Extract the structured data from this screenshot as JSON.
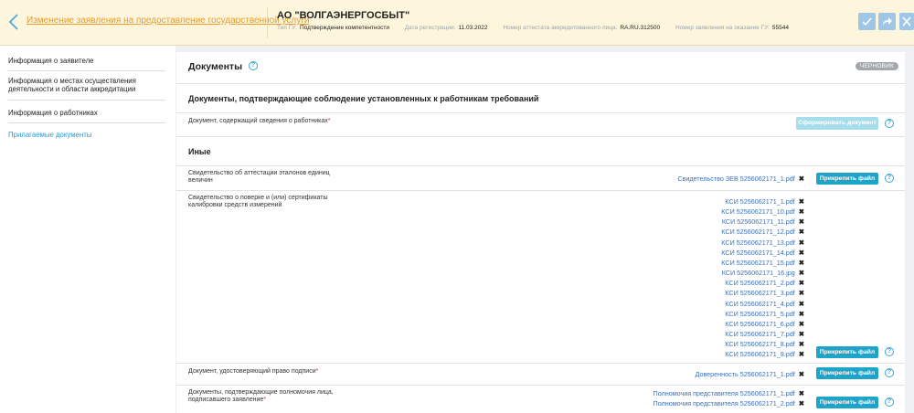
{
  "header": {
    "back_label": "Изменение заявления на предоставление государственной услуги",
    "org_name": "АО \"ВОЛГАЭНЕРГОСБЫТ\"",
    "meta": [
      {
        "label": "Тип ГУ:",
        "value": "Подтверждение компетентности"
      },
      {
        "label": "Дата регистрации:",
        "value": "11.03.2022"
      },
      {
        "label": "Номер аттестата аккредитованного лица:",
        "value": "RA.RU.312500"
      },
      {
        "label": "Номер заявления на оказание ГУ:",
        "value": "55544"
      }
    ],
    "accent_color": "#e79b2e",
    "icons": [
      "chevron-left-icon",
      "check-icon",
      "share-icon",
      "close-icon"
    ]
  },
  "sidebar": {
    "items": [
      {
        "label": "Информация о заявителе"
      },
      {
        "label": "Информация о местах осуществления деятельности и области аккредитации"
      },
      {
        "label": "Информация о работниках"
      },
      {
        "label": "Прилагаемые документы",
        "active": true
      }
    ]
  },
  "main": {
    "title": "Документы",
    "status_badge": "ЧЕРНОВИК",
    "section1_title": "Документы, подтверждающие соблюдение установленных к работникам требований",
    "section1_doc": {
      "label": "Документ, содержащий сведения о работниках",
      "required_mark": "*",
      "button": "Сформировать документ"
    },
    "section2_title": "Иные",
    "attach_button": "Прикрепить файл",
    "docs": [
      {
        "label": "Свидетельство об аттестации эталонов единиц величин",
        "files": [
          "Свидетельство ЗЕВ 5256062171_1.pdf"
        ]
      },
      {
        "label": "Свидетельство о поверке и (или) сертификаты калибровки средств измерений",
        "files": [
          "КСИ 5256062171_1.pdf",
          "КСИ 5256062171_10.pdf",
          "КСИ 5256062171_11.pdf",
          "КСИ 5256062171_12.pdf",
          "КСИ 5256062171_13.pdf",
          "КСИ 5256062171_14.pdf",
          "КСИ 5256062171_15.pdf",
          "КСИ 5256062171_16.jpg",
          "КСИ 5256062171_2.pdf",
          "КСИ 5256062171_3.pdf",
          "КСИ 5256062171_4.pdf",
          "КСИ 5256062171_5.pdf",
          "КСИ 5256062171_6.pdf",
          "КСИ 5256062171_7.pdf",
          "КСИ 5256062171_8.pdf",
          "КСИ 5256062171_9.pdf"
        ]
      },
      {
        "label": "Документ, удостоверяющий право подписи",
        "required_mark": "*",
        "files": [
          "Доверенность 5256062171_1.pdf"
        ]
      },
      {
        "label": "Документы, подтверждающие полномочия лица, подписавшего заявление",
        "required_mark": "*",
        "files": [
          "Полномочия представителя 5256062171_1.pdf",
          "Полномочия представителя 5256062171_2.pdf"
        ]
      }
    ],
    "remove_glyph": "✖",
    "help_glyph": "?"
  }
}
